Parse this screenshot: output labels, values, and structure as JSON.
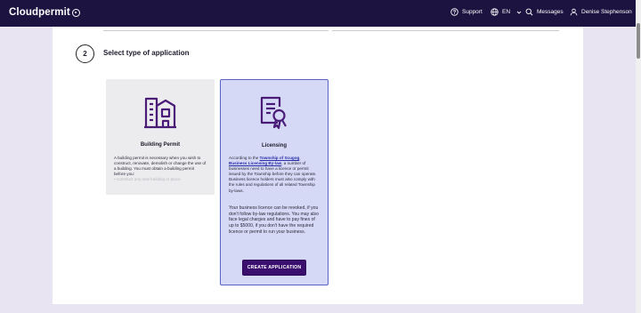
{
  "header": {
    "logo": "Cloudpermit",
    "support": "Support",
    "language": "EN",
    "messages": "Messages",
    "user": "Denise Stephenson"
  },
  "step": {
    "number": "2",
    "title": "Select type of application"
  },
  "cards": {
    "building": {
      "title": "Building Permit",
      "desc": "A building permit is necessary when you wish to construct, renovate, demolish or change the use of a building. You must obtain a building permit before you:",
      "bullet": "• construct any new building or place"
    },
    "licensing": {
      "title": "Licensing",
      "desc_pre": "According to the ",
      "link1": "Township of Scugog",
      "link2": "Business Licensing By-law",
      "desc_post": ", a number of businesses need to have a licence or permit issued by the Township before they can operate. Business licence holders must also comply with the rules and regulations of all related Township by-laws.",
      "desc2": "Your business licence can be revoked, if you don't follow by-law regulations. You may also face legal charges and have to pay fines of up to $5000, if you don't have the required licence or permit to run your business.",
      "button": "CREATE APPLICATION"
    }
  },
  "colors": {
    "topbar": "#1d1340",
    "accent": "#3a0f6e",
    "selected_card": "#d5d9f6",
    "icon_purple": "#4a1c78"
  }
}
